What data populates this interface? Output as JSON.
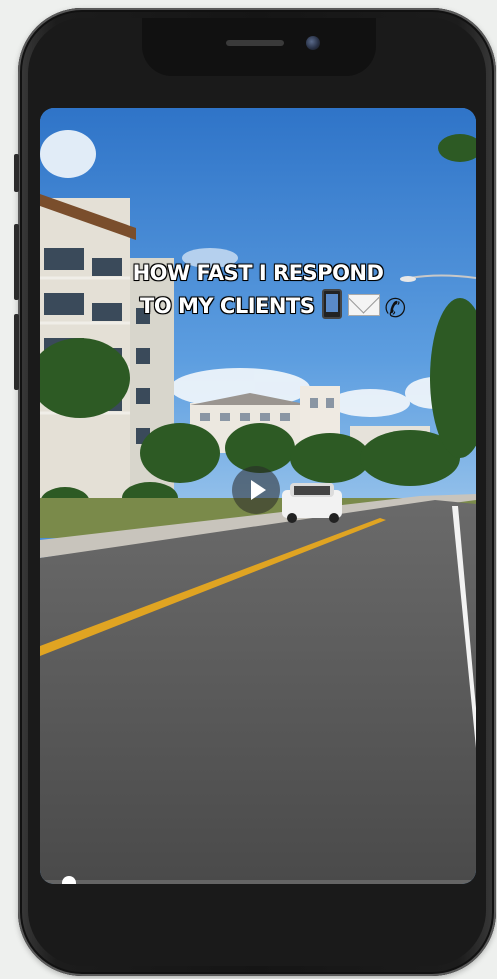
{
  "video": {
    "caption_line1": "HOW FAST I RESPOND",
    "caption_line2": "TO MY CLIENTS",
    "emojis": [
      "mobile-phone-icon",
      "envelope-icon",
      "telephone-receiver-icon"
    ],
    "playback": "paused",
    "progress_fraction": 0.0
  },
  "colors": {
    "sky": "#4a8fd4",
    "road": "#5a5a5a",
    "road_line": "#e0a422",
    "phone_frame": "#1a1a1a"
  }
}
